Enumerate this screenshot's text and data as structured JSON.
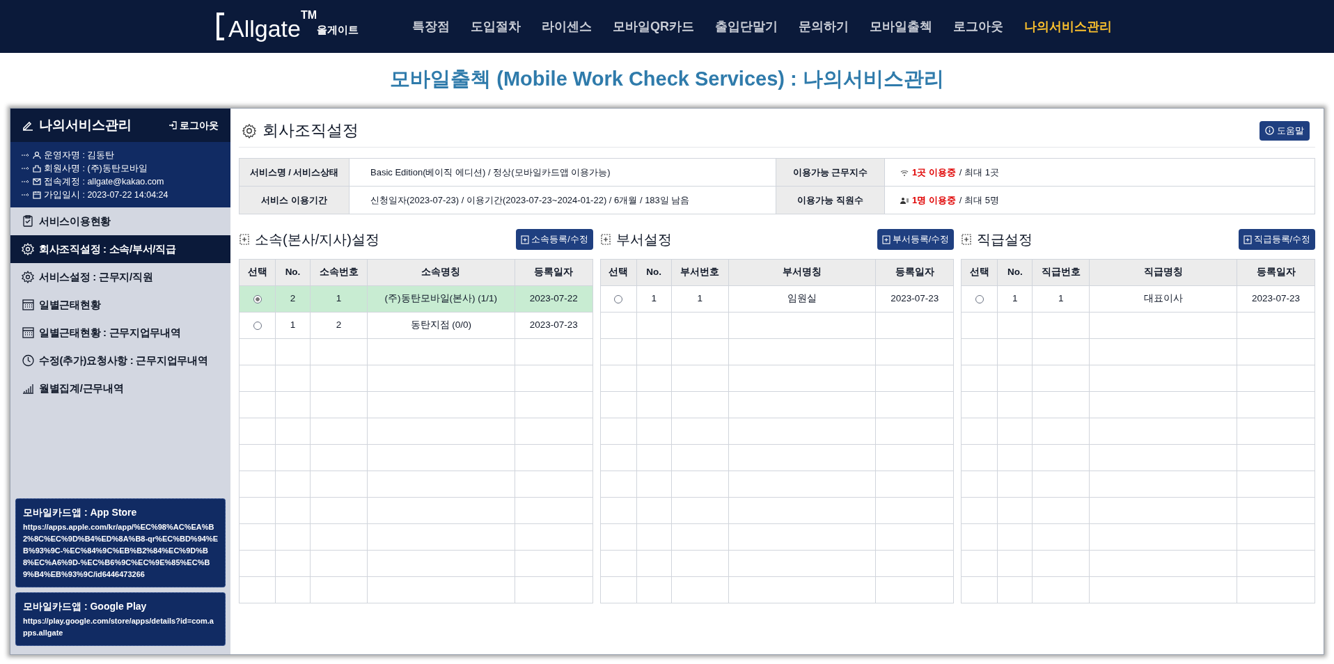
{
  "nav": {
    "logo": "Allgate",
    "logo_tm": "TM",
    "logo_sub": "올게이트",
    "items": [
      {
        "label": "특장점",
        "selected": false
      },
      {
        "label": "도입절차",
        "selected": false
      },
      {
        "label": "라이센스",
        "selected": false
      },
      {
        "label": "모바일QR카드",
        "selected": false
      },
      {
        "label": "출입단말기",
        "selected": false
      },
      {
        "label": "문의하기",
        "selected": false
      },
      {
        "label": "모바일출첵",
        "selected": false
      },
      {
        "label": "로그아웃",
        "selected": false
      },
      {
        "label": "나의서비스관리",
        "selected": true
      }
    ]
  },
  "page_title": "모바일출첵 (Mobile Work Check Services) : 나의서비스관리",
  "sidebar": {
    "title": "나의서비스관리",
    "logout": "로그아웃",
    "info": [
      {
        "kind": "user",
        "text": "운영자명 : 김동탄"
      },
      {
        "kind": "company",
        "text": "회원사명 : (주)동탄모바일"
      },
      {
        "kind": "mail",
        "text": "접속계정 : allgate@kakao.com"
      },
      {
        "kind": "calendar",
        "text": "가입일시 : 2023-07-22 14:04:24"
      }
    ],
    "items": [
      {
        "kind": "clipboard",
        "label": "서비스이용현황",
        "selected": false
      },
      {
        "kind": "gear",
        "label": "회사조직설정 : 소속/부서/직급",
        "selected": true
      },
      {
        "kind": "gear",
        "label": "서비스설정 : 근무지/직원",
        "selected": false
      },
      {
        "kind": "calendar",
        "label": "일별근태현황",
        "selected": false
      },
      {
        "kind": "calendar",
        "label": "일별근태현황 : 근무지업무내역",
        "selected": false
      },
      {
        "kind": "clock",
        "label": "수정(추가)요청사항 : 근무지업무내역",
        "selected": false
      },
      {
        "kind": "chart",
        "label": "월별집계/근무내역",
        "selected": false
      }
    ],
    "cards": [
      {
        "title": "모바일카드앱 : App Store",
        "url": "https://apps.apple.com/kr/app/%EC%98%AC%EA%B2%8C%EC%9D%B4%ED%8A%B8-qr%EC%BD%94%EB%93%9C-%EC%84%9C%EB%B2%84%EC%9D%B8%EC%A6%9D-%EC%B6%9C%EC%9E%85%EC%B9%B4%EB%93%9C/id6446473266"
      },
      {
        "title": "모바일카드앱 : Google Play",
        "url": "https://play.google.com/store/apps/details?id=com.apps.allgate"
      }
    ]
  },
  "content": {
    "title": "회사조직설정",
    "help_button": "도움말",
    "info_table": [
      {
        "label": "서비스명 / 서비스상태",
        "value": "Basic Edition(베이직 에디션) / 정상(모바일카드앱 이용가능)",
        "label2": "이용가능 근무지수",
        "kind": "wifi",
        "highlight2": "1곳 이용중",
        "value2": "/ 최대 1곳"
      },
      {
        "label": "서비스 이용기간",
        "value": "신청일자(2023-07-23) / 이용기간(2023-07-23~2024-01-22) / 6개월 / 183일 남음",
        "label2": "이용가능 직원수",
        "kind": "people",
        "highlight2": "1명 이용중",
        "value2": "/ 최대 5명"
      }
    ],
    "panels": [
      {
        "title": "소속(본사/지사)설정",
        "button": "소속등록/수정",
        "columns": [
          "선택",
          "No.",
          "소속번호",
          "소속명칭",
          "등록일자"
        ],
        "rows": [
          {
            "selected": true,
            "cells": [
              "",
              "2",
              "1",
              "(주)동탄모바일(본사) (1/1)",
              "2023-07-22"
            ]
          },
          {
            "selected": false,
            "cells": [
              "",
              "1",
              "2",
              "동탄지점 (0/0)",
              "2023-07-23"
            ]
          }
        ]
      },
      {
        "title": "부서설정",
        "button": "부서등록/수정",
        "columns": [
          "선택",
          "No.",
          "부서번호",
          "부서명칭",
          "등록일자"
        ],
        "rows": [
          {
            "selected": false,
            "cells": [
              "",
              "1",
              "1",
              "임원실",
              "2023-07-23"
            ]
          }
        ]
      },
      {
        "title": "직급설정",
        "button": "직급등록/수정",
        "columns": [
          "선택",
          "No.",
          "직급번호",
          "직급명칭",
          "등록일자"
        ],
        "rows": [
          {
            "selected": false,
            "cells": [
              "",
              "1",
              "1",
              "대표이사",
              "2023-07-23"
            ]
          }
        ]
      }
    ]
  }
}
